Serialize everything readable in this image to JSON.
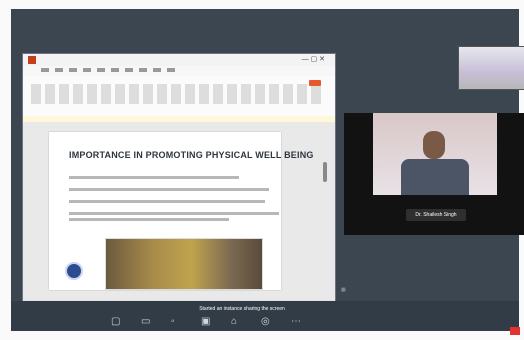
{
  "meeting": {
    "slide": {
      "title": "IMPORTANCE IN PROMOTING PHYSICAL WELL BEING"
    },
    "speaker": {
      "name": "Dr. Shailesh Singh"
    },
    "share_status": "Started an instance sharing the screen",
    "colors": {
      "meeting_bg": "#3b4650",
      "end_call": "#e2312e",
      "name_tag": "#2f2f2f"
    }
  }
}
